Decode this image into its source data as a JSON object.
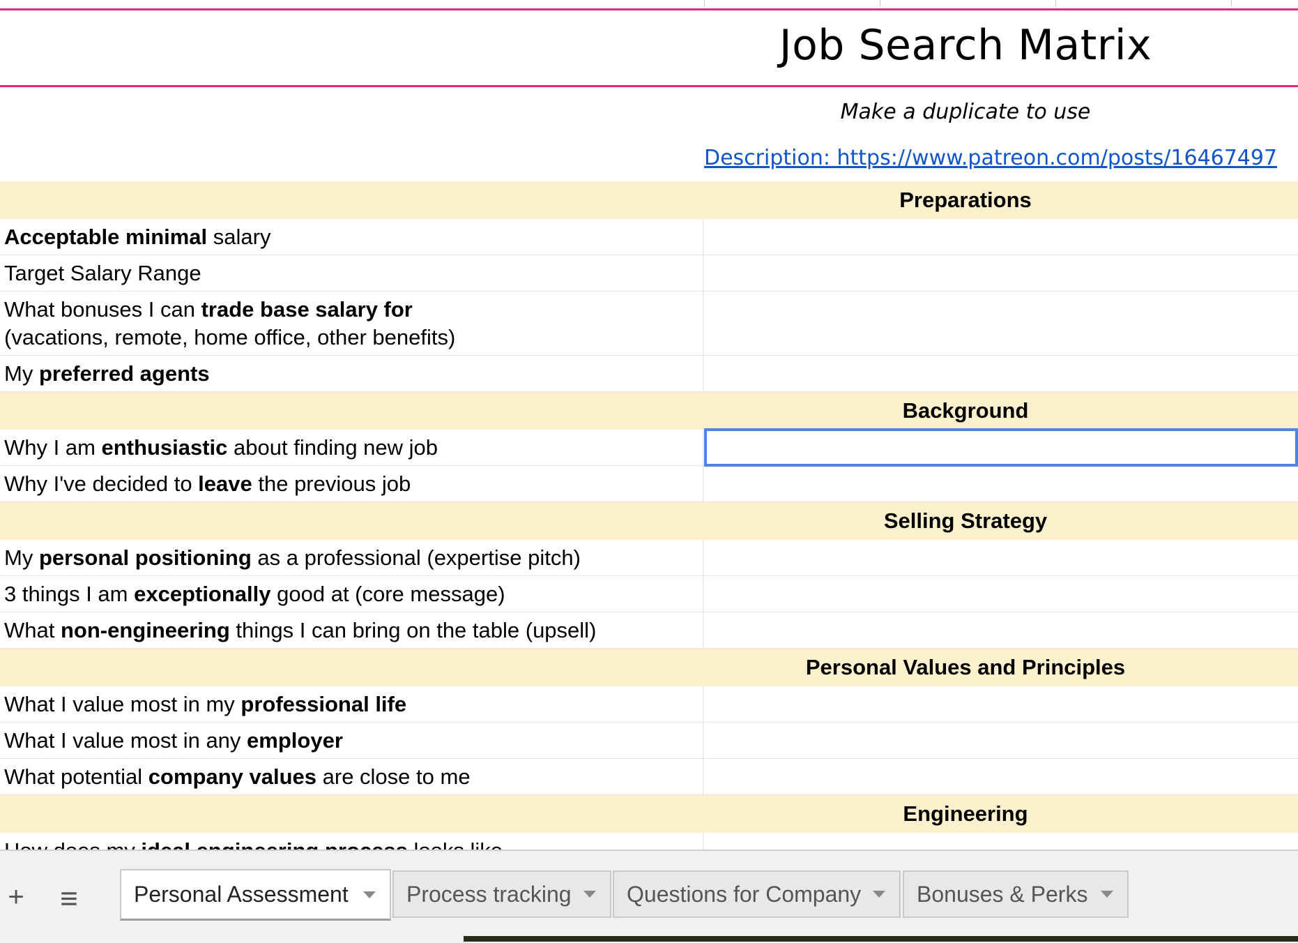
{
  "title": "Job Search Matrix",
  "subtitle": "Make a duplicate to use",
  "link": "Description: https://www.patreon.com/posts/16467497",
  "sections": {
    "preparations": "Preparations",
    "background": "Background",
    "selling": "Selling Strategy",
    "values": "Personal Values and Principles",
    "engineering": "Engineering"
  },
  "rows": {
    "r1": {
      "b": "Acceptable minimal",
      "t": " salary"
    },
    "r2": {
      "t": "Target Salary Range"
    },
    "r3": {
      "p": "What bonuses I can ",
      "b": "trade base salary for",
      "t2": "(vacations, remote, home office, other benefits)"
    },
    "r4": {
      "p": "My ",
      "b": "preferred agents"
    },
    "r5": {
      "p": "Why I am ",
      "b": "enthusiastic",
      "t": " about finding new job"
    },
    "r6": {
      "p": "Why I've decided to ",
      "b": "leave",
      "t": " the previous job"
    },
    "r7": {
      "p": "My ",
      "b": "personal positioning",
      "t": " as a professional (expertise pitch)"
    },
    "r8": {
      "p": "3 things I am ",
      "b": "exceptionally",
      "t": " good at (core message)"
    },
    "r9": {
      "p": "What ",
      "b": "non-engineering",
      "t": " things I can bring on the table (upsell)"
    },
    "r10": {
      "p": "What I value most in my ",
      "b": "professional life"
    },
    "r11": {
      "p": "What I value most in any ",
      "b": "employer"
    },
    "r12": {
      "p": "What potential ",
      "b": "company values",
      "t": " are close to me"
    },
    "r13": {
      "p": "How does my ",
      "b": "ideal engineering process",
      "t": " looks like"
    }
  },
  "tabbar": {
    "add_icon": "+",
    "menu_icon": "≡",
    "tabs": [
      {
        "label": "Personal Assessment",
        "active": true
      },
      {
        "label": "Process tracking",
        "active": false
      },
      {
        "label": "Questions for Company",
        "active": false
      },
      {
        "label": "Bonuses & Perks",
        "active": false
      }
    ]
  },
  "colors": {
    "accent": "#e2287f",
    "section_bg": "#fdf0cd",
    "link": "#1155cc",
    "selection": "#4a86e8"
  }
}
